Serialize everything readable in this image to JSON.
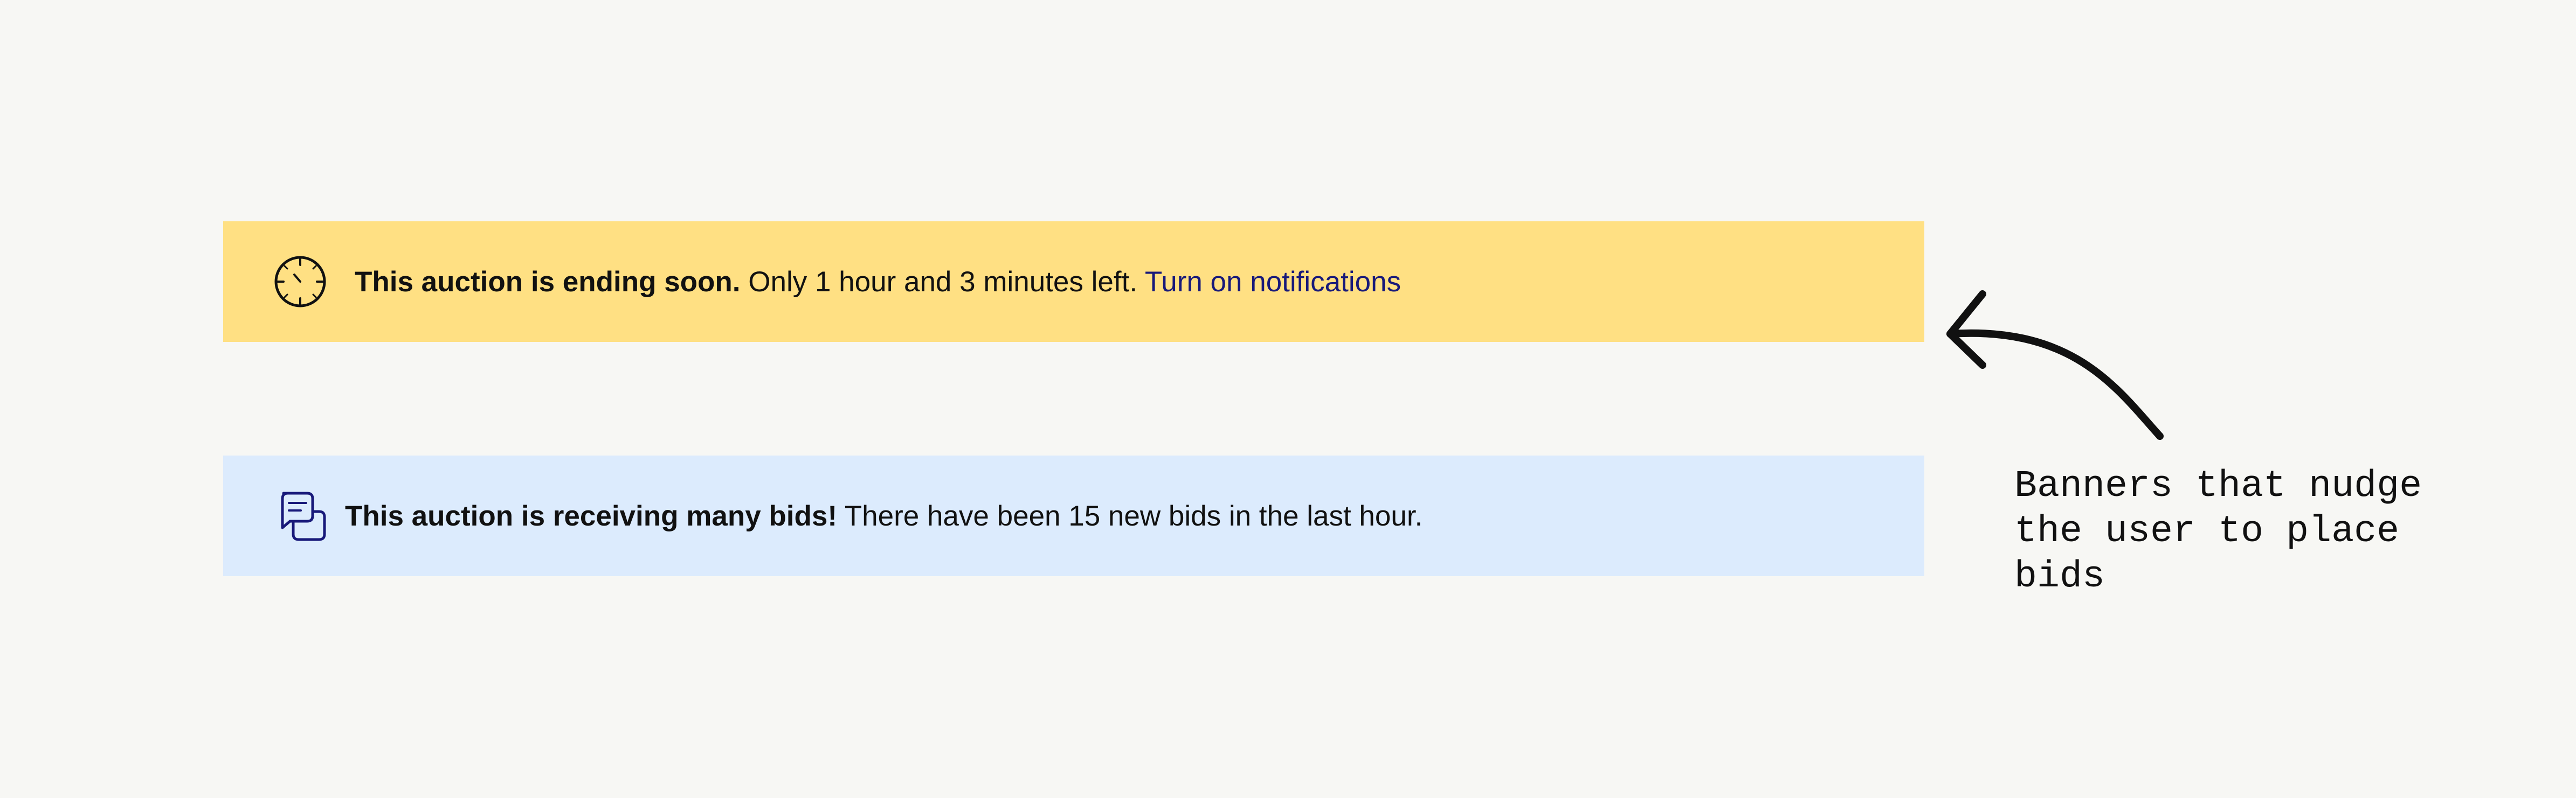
{
  "banners": [
    {
      "icon": "clock-icon",
      "bold_text": "This auction is ending soon.",
      "text": " Only 1 hour and 3 minutes left. ",
      "link_text": "Turn on notifications",
      "background": "#ffe083",
      "link_color": "#18197a"
    },
    {
      "icon": "chat-bubbles-icon",
      "bold_text": "This auction is receiving many bids!",
      "text": " There have been 15 new bids in the last hour.",
      "background": "#dcebfd",
      "icon_color": "#18197a"
    }
  ],
  "annotation": {
    "lines": [
      "Banners that nudge",
      "the user to place",
      "bids"
    ]
  }
}
